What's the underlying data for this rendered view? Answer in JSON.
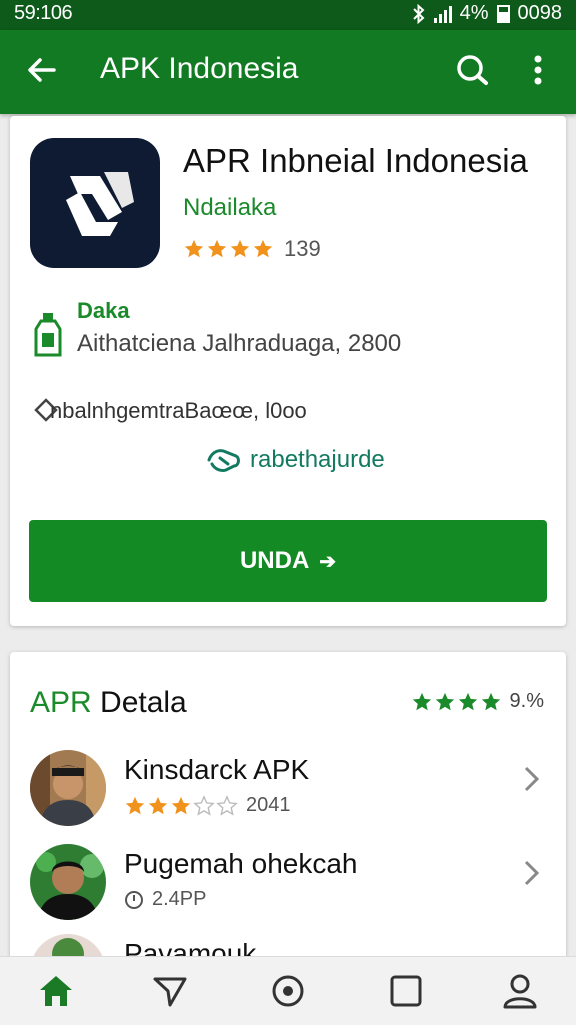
{
  "status_bar": {
    "time": "59:106",
    "battery": "4%",
    "clock_right": "0098"
  },
  "app_bar": {
    "title": "APK Indonesia"
  },
  "app_card": {
    "name": "APR Inbneial Indonesia",
    "developer": "Ndailaka",
    "rating_stars": 4,
    "rating_count": "139",
    "location_label": "Daka",
    "location_address": "Aithatciena Jalhraduaga, 2800",
    "info_text": "nbalnhgemtraBaœœ, l0oo",
    "link_text": "rabethajurde",
    "cta_label": "UNDA",
    "cta_arrow": "➔"
  },
  "details": {
    "title_accent": "APR",
    "title_rest": " Detala",
    "rating_stars": 4,
    "rating_percent": "9.%",
    "items": [
      {
        "name": "Kinsdarck APK",
        "meta": "2041",
        "rating_stars": 3,
        "meta_type": "rating"
      },
      {
        "name": "Pugemah ohekcah",
        "meta": "2.4PP",
        "meta_type": "clock"
      },
      {
        "name": "Pavamouk",
        "meta": "",
        "meta_type": "none"
      }
    ]
  },
  "colors": {
    "primary_green": "#127a22",
    "dark_green": "#0d5a1a",
    "accent_green": "#1b8a2a",
    "star_orange": "#f0921c",
    "icon_navy": "#0f1b33"
  },
  "bottom_nav": [
    "home-icon",
    "send-icon",
    "record-icon",
    "square-icon",
    "profile-icon"
  ]
}
